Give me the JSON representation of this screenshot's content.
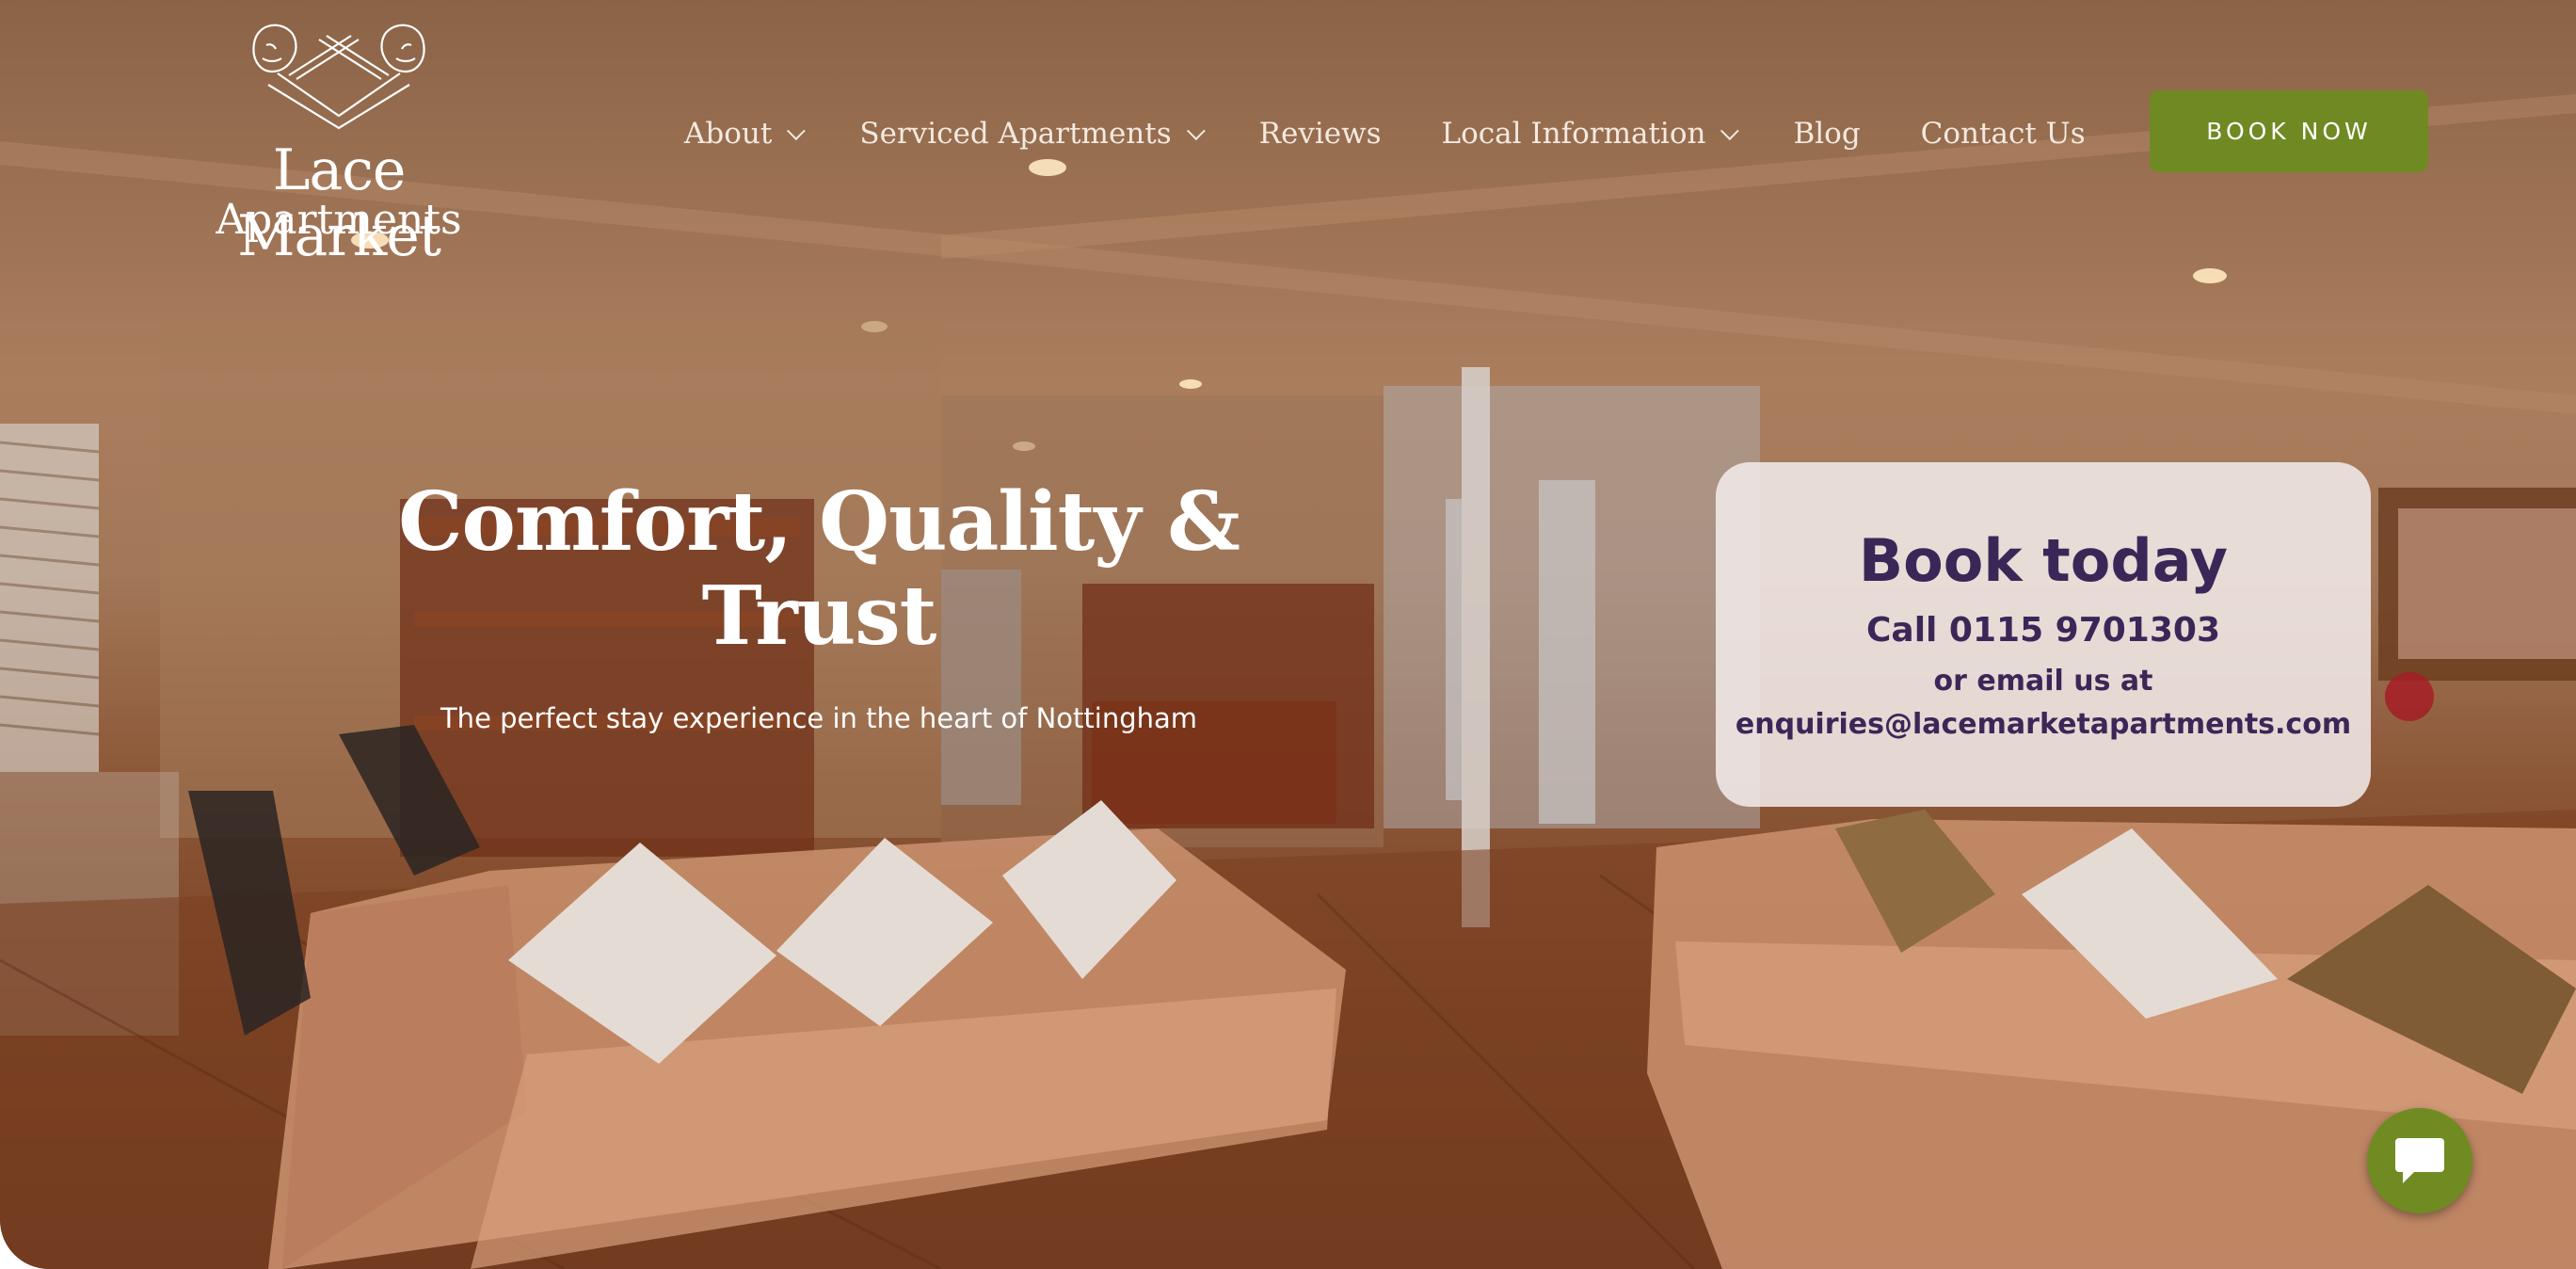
{
  "brand": {
    "name_line1": "Lace Market",
    "name_line2": "Apartments",
    "logo_icon": "twin-lion-head-icon"
  },
  "nav": {
    "items": [
      {
        "label": "About",
        "has_dropdown": true
      },
      {
        "label": "Serviced Apartments",
        "has_dropdown": true
      },
      {
        "label": "Reviews",
        "has_dropdown": false
      },
      {
        "label": "Local Information",
        "has_dropdown": true
      },
      {
        "label": "Blog",
        "has_dropdown": false
      },
      {
        "label": "Contact Us",
        "has_dropdown": false
      }
    ],
    "cta_label": "BOOK NOW"
  },
  "hero": {
    "headline": "Comfort, Quality & Trust",
    "subline": "The perfect stay experience in the heart of Nottingham",
    "background": "apartment-living-room-photo"
  },
  "booking_card": {
    "title": "Book today",
    "phone": "Call 0115 9701303",
    "email_prefix": "or email us at",
    "email": "enquiries@lacemarketapartments.com"
  },
  "chat": {
    "icon": "chat-bubble-icon"
  },
  "colors": {
    "accent_green": "#6f8a22",
    "card_text_purple": "#3b2757",
    "nav_text": "#f4e9df"
  }
}
